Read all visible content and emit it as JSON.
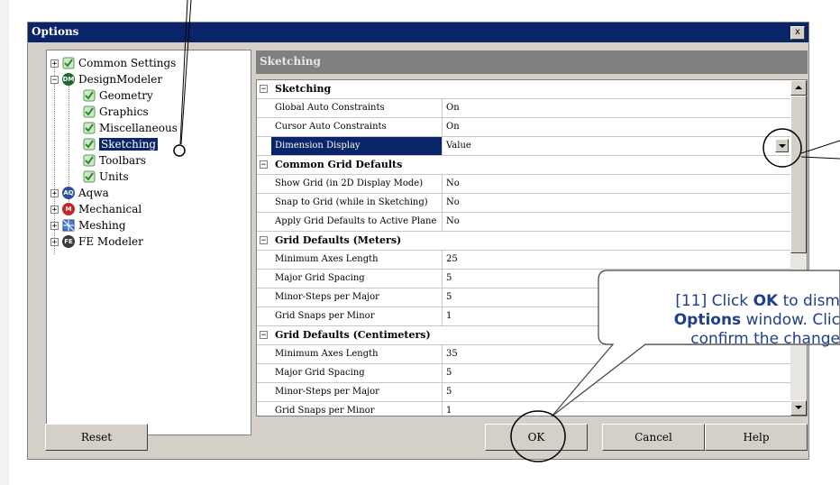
{
  "dialog": {
    "title": "Options",
    "close_label": "x"
  },
  "tree": {
    "items": [
      {
        "label": "Common Settings"
      },
      {
        "label": "DesignModeler",
        "badge": "DM"
      },
      {
        "label": "Geometry"
      },
      {
        "label": "Graphics"
      },
      {
        "label": "Miscellaneous"
      },
      {
        "label": "Sketching"
      },
      {
        "label": "Toolbars"
      },
      {
        "label": "Units"
      },
      {
        "label": "Aqwa",
        "badge": "AQ"
      },
      {
        "label": "Mechanical",
        "badge": "M"
      },
      {
        "label": "Meshing"
      },
      {
        "label": "FE Modeler",
        "badge": "FE"
      }
    ]
  },
  "panel": {
    "header": "Sketching"
  },
  "grid": {
    "sections": [
      {
        "title": "Sketching",
        "rows": [
          {
            "name": "Global Auto Constraints",
            "value": "On"
          },
          {
            "name": "Cursor Auto Constraints",
            "value": "On"
          },
          {
            "name": "Dimension Display",
            "value": "Value"
          }
        ]
      },
      {
        "title": "Common Grid Defaults",
        "rows": [
          {
            "name": "Show Grid (in 2D Display Mode)",
            "value": "No"
          },
          {
            "name": "Snap to Grid (while in Sketching)",
            "value": "No"
          },
          {
            "name": "Apply Grid Defaults to Active Plane",
            "value": "No"
          }
        ]
      },
      {
        "title": "Grid Defaults (Meters)",
        "rows": [
          {
            "name": "Minimum Axes Length",
            "value": "25"
          },
          {
            "name": "Major Grid Spacing",
            "value": "5"
          },
          {
            "name": "Minor-Steps per Major",
            "value": "5"
          },
          {
            "name": "Grid Snaps per Minor",
            "value": "1"
          }
        ]
      },
      {
        "title": "Grid Defaults (Centimeters)",
        "rows": [
          {
            "name": "Minimum Axes Length",
            "value": "35"
          },
          {
            "name": "Major Grid Spacing",
            "value": "5"
          },
          {
            "name": "Minor-Steps per Major",
            "value": "5"
          },
          {
            "name": "Grid Snaps per Minor",
            "value": "1"
          }
        ]
      }
    ]
  },
  "buttons": {
    "reset": "Reset",
    "ok": "OK",
    "cancel": "Cancel",
    "help": "Help"
  },
  "callout": {
    "line1_prefix": "[11] Click ",
    "line1_bold": "OK",
    "line1_suffix": " to dism",
    "line2_bold": "Options",
    "line2_suffix": " window. Clic",
    "line3": "confirm the change"
  },
  "colors": {
    "title_bar": "#0a246a",
    "dialog_face": "#d4d0c8",
    "callout_text": "#1f3f8a"
  }
}
